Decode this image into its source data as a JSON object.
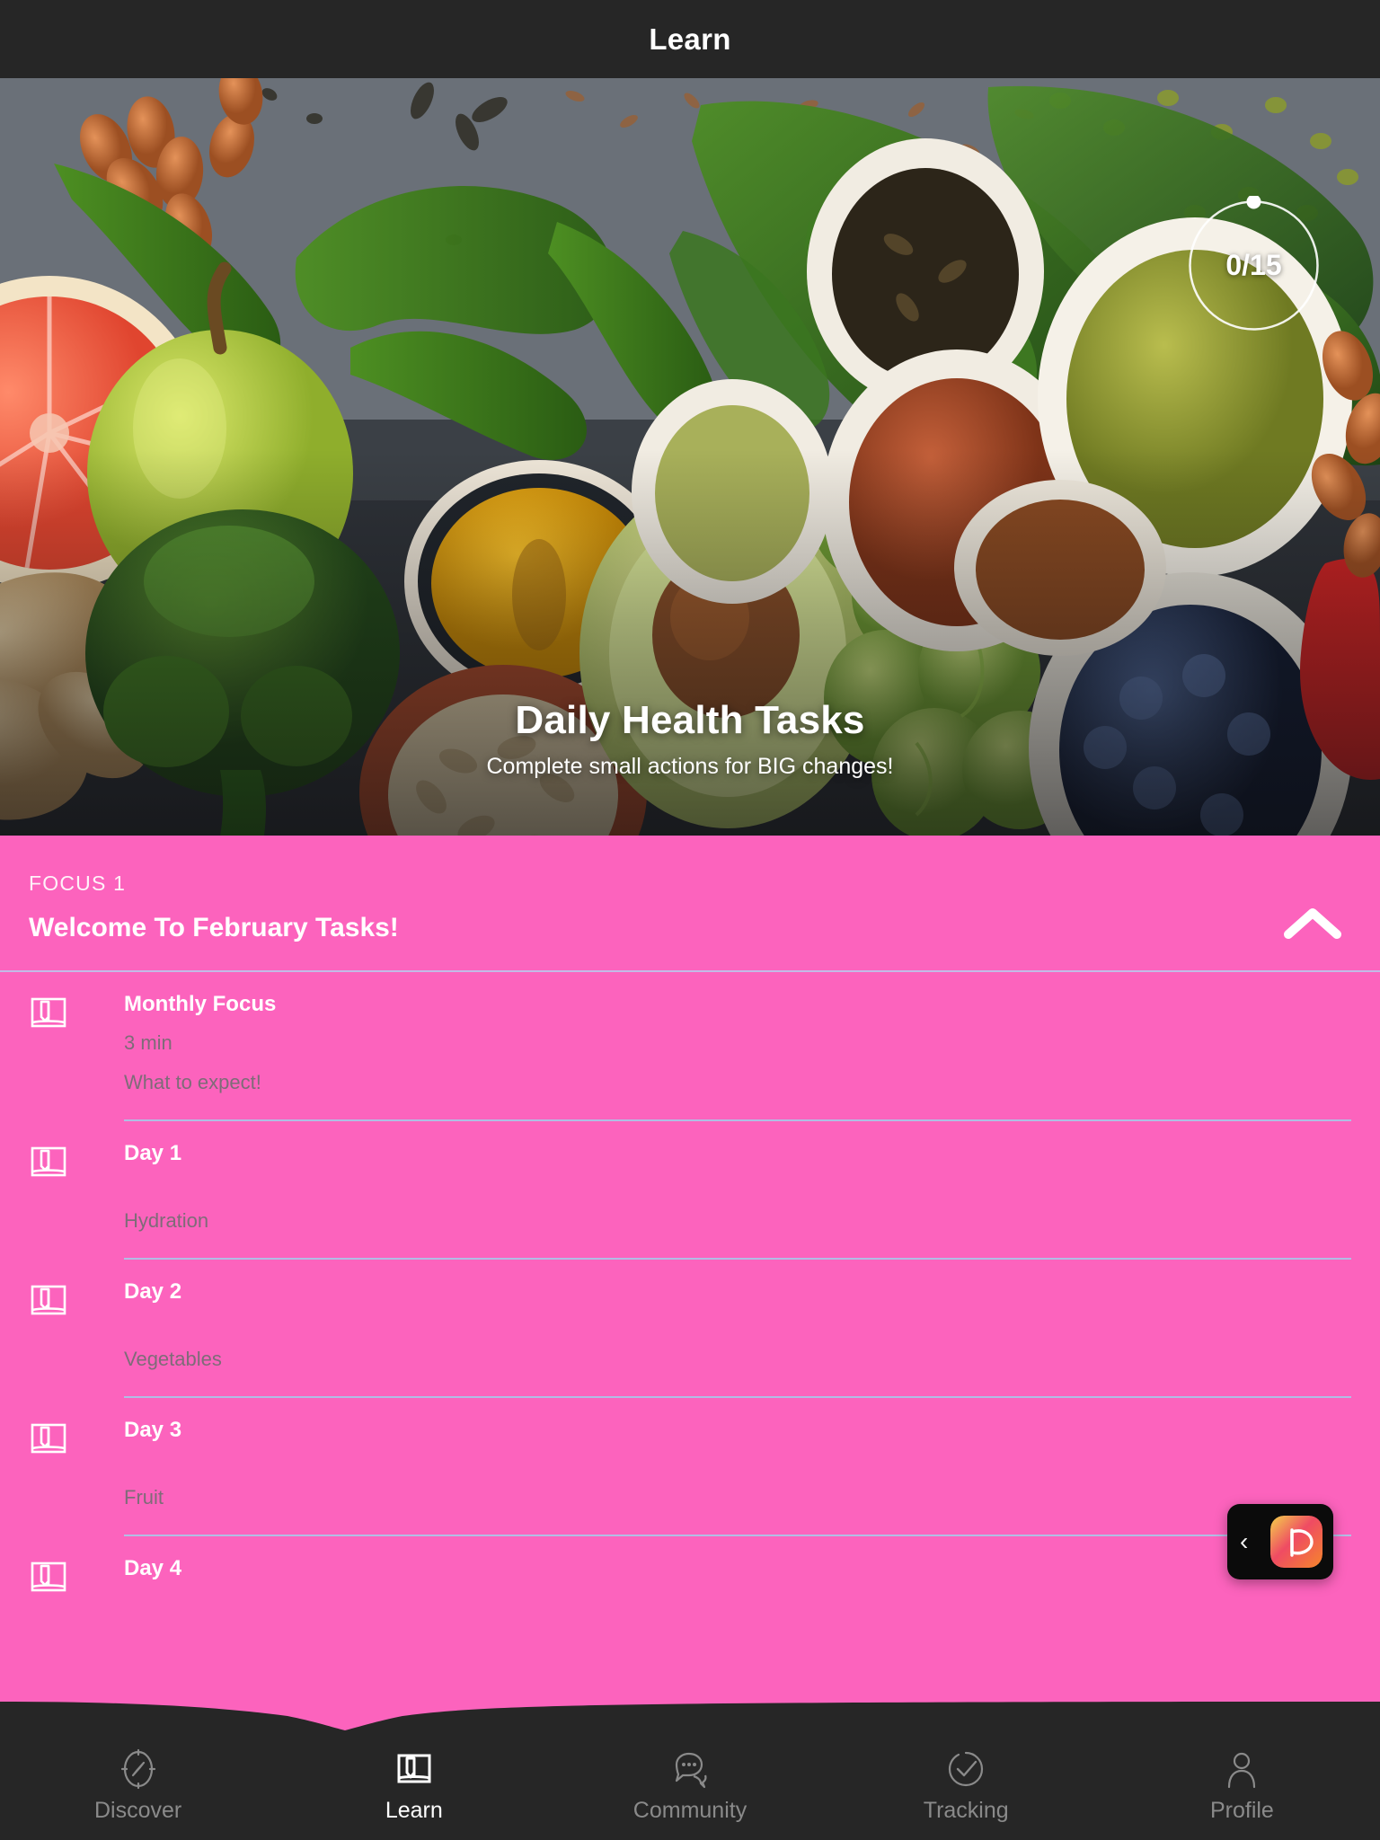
{
  "topbar": {
    "title": "Learn"
  },
  "hero": {
    "title": "Daily Health Tasks",
    "subtitle": "Complete small actions for BIG changes!",
    "progress": {
      "label": "0/15",
      "completed": 0,
      "total": 15
    },
    "image_alt": "flat-lay of healthy foods: grapefruit, green apple, almonds, green chilies, spinach, broccoli, ginger, turmeric powder, oats, avocado, brussels sprouts, flax seeds, mung beans, red rice, blueberries"
  },
  "focus": {
    "kicker": "FOCUS 1",
    "title": "Welcome To February Tasks!",
    "collapse_icon": "chevron-up-icon",
    "expanded": true
  },
  "tasks": [
    {
      "icon": "book-icon",
      "title": "Monthly Focus",
      "duration": "3 min",
      "description": "What to expect!"
    },
    {
      "icon": "book-icon",
      "title": "Day 1",
      "duration": "",
      "description": "Hydration"
    },
    {
      "icon": "book-icon",
      "title": "Day 2",
      "duration": "",
      "description": "Vegetables"
    },
    {
      "icon": "book-icon",
      "title": "Day 3",
      "duration": "",
      "description": "Fruit"
    },
    {
      "icon": "book-icon",
      "title": "Day 4",
      "duration": "",
      "description": ""
    }
  ],
  "floating_widget": {
    "back_glyph": "‹",
    "app_icon": "app-logo-icon"
  },
  "bottom_nav": {
    "items": [
      {
        "label": "Discover",
        "icon": "compass-icon",
        "active": false
      },
      {
        "label": "Learn",
        "icon": "book-icon",
        "active": true
      },
      {
        "label": "Community",
        "icon": "chat-bubbles-icon",
        "active": false
      },
      {
        "label": "Tracking",
        "icon": "check-circle-icon",
        "active": false
      },
      {
        "label": "Profile",
        "icon": "person-icon",
        "active": false
      }
    ]
  },
  "colors": {
    "accent_pink": "#FC63BD",
    "bar_dark": "#262626",
    "divider_blue": "#A9C6E8",
    "muted_text": "#7E6C78",
    "nav_inactive": "#8A8A8A"
  }
}
